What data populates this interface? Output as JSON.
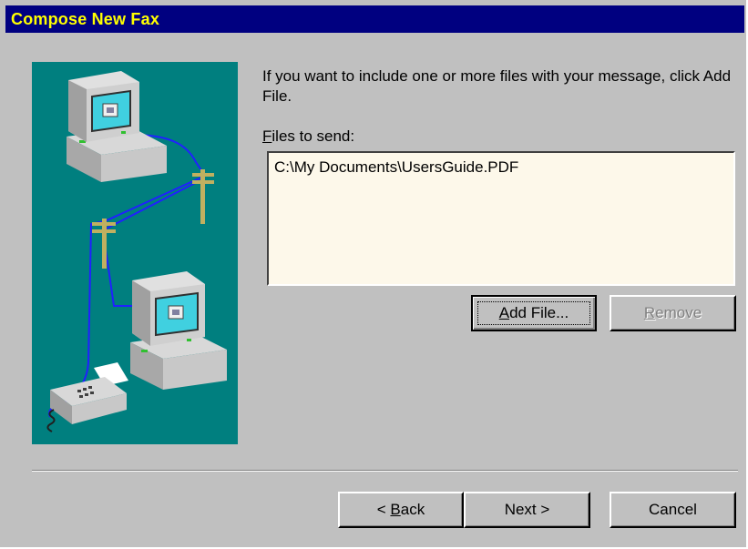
{
  "window": {
    "title": "Compose New Fax"
  },
  "instruction": "If you want to include one or more files with your message, click Add File.",
  "files": {
    "label_accel": "F",
    "label_rest": "iles to send:",
    "items": [
      "C:\\My Documents\\UsersGuide.PDF"
    ]
  },
  "buttons": {
    "add_file": {
      "accel": "A",
      "rest": "dd File..."
    },
    "remove": {
      "accel": "R",
      "rest": "emove"
    },
    "back": {
      "prefix": "< ",
      "accel": "B",
      "rest": "ack"
    },
    "next": {
      "label": "Next >"
    },
    "cancel": {
      "label": "Cancel"
    }
  },
  "colors": {
    "title_bar": "#000080",
    "title_text": "#ffff00",
    "illustration_bg": "#007f7f",
    "listbox_bg": "#fdf8ea"
  },
  "icons": [
    "computer-icon",
    "telephone-pole-icon",
    "fax-machine-icon"
  ]
}
